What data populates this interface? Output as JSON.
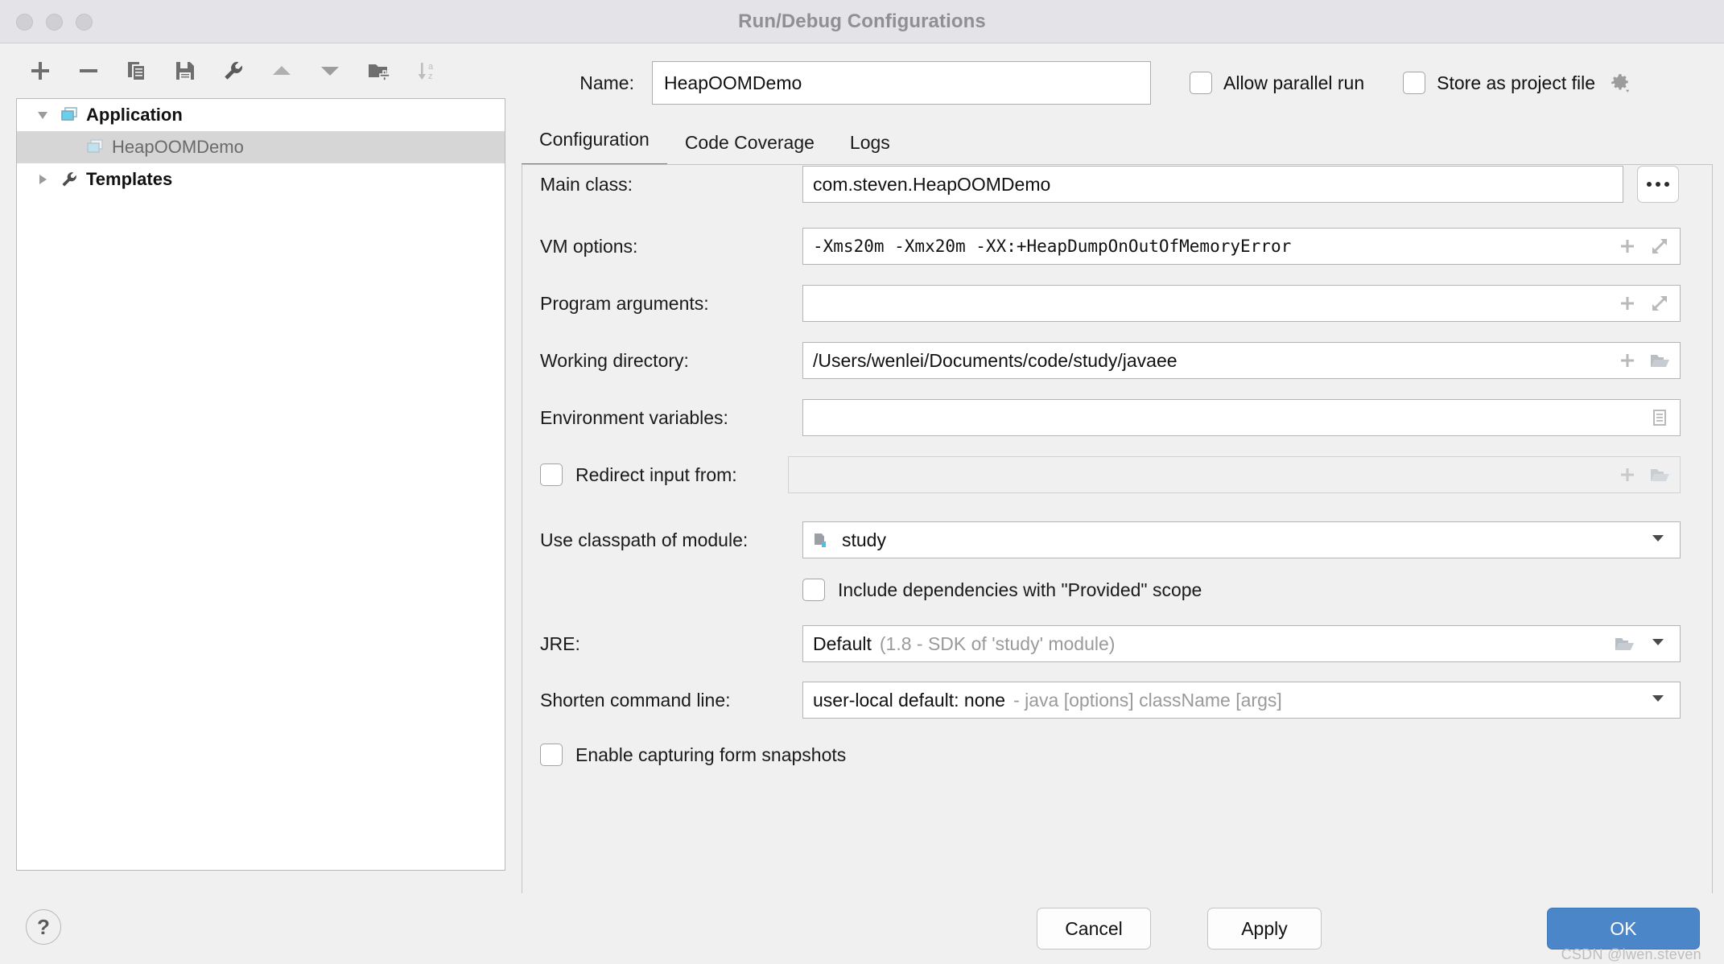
{
  "window": {
    "title": "Run/Debug Configurations",
    "traffic_lights": [
      "close",
      "minimize",
      "zoom"
    ]
  },
  "toolbar": {
    "buttons": [
      {
        "name": "add",
        "icon": "plus-icon",
        "label": "Add New Configuration"
      },
      {
        "name": "remove",
        "icon": "minus-icon",
        "label": "Remove Configuration"
      },
      {
        "name": "copy",
        "icon": "copy-icon",
        "label": "Copy Configuration"
      },
      {
        "name": "save",
        "icon": "save-icon",
        "label": "Save Configuration"
      },
      {
        "name": "edit-templates",
        "icon": "wrench-icon",
        "label": "Edit Templates"
      },
      {
        "name": "move-up",
        "icon": "triangle-up-icon",
        "label": "Move Up"
      },
      {
        "name": "move-down",
        "icon": "triangle-down-icon",
        "label": "Move Down"
      },
      {
        "name": "new-folder",
        "icon": "folder-plus-icon",
        "label": "Create New Folder"
      },
      {
        "name": "sort-alphabetically",
        "icon": "sort-az-icon",
        "label": "Sort Configurations"
      }
    ]
  },
  "tree": {
    "nodes": [
      {
        "label": "Application",
        "icon": "application-icon",
        "expanded": true,
        "selected": false,
        "level": 0
      },
      {
        "label": "HeapOOMDemo",
        "icon": "application-icon",
        "expanded": false,
        "selected": true,
        "level": 1
      },
      {
        "label": "Templates",
        "icon": "wrench-icon",
        "expanded": false,
        "selected": false,
        "level": 0
      }
    ]
  },
  "name_row": {
    "label": "Name:",
    "value": "HeapOOMDemo",
    "allow_parallel_run": {
      "label": "Allow parallel run",
      "checked": false
    },
    "store_as_project_file": {
      "label": "Store as project file",
      "checked": false
    },
    "gear_icon": "gear-icon"
  },
  "tabs": [
    {
      "label": "Configuration",
      "active": true
    },
    {
      "label": "Code Coverage",
      "active": false
    },
    {
      "label": "Logs",
      "active": false
    }
  ],
  "fields": {
    "main_class": {
      "label": "Main class:",
      "value": "com.steven.HeapOOMDemo",
      "browse_label": "..."
    },
    "vm_options": {
      "label": "VM options:",
      "value": "-Xms20m -Xmx20m -XX:+HeapDumpOnOutOfMemoryError",
      "icons": [
        "plus-macro-icon",
        "expand-icon"
      ]
    },
    "program_arguments": {
      "label": "Program arguments:",
      "value": "",
      "icons": [
        "plus-macro-icon",
        "expand-icon"
      ]
    },
    "working_directory": {
      "label": "Working directory:",
      "value": "/Users/wenlei/Documents/code/study/javaee",
      "icons": [
        "plus-macro-icon",
        "folder-icon"
      ]
    },
    "environment_variables": {
      "label": "Environment variables:",
      "value": "",
      "icons": [
        "list-edit-icon"
      ]
    },
    "redirect_input": {
      "label": "Redirect input from:",
      "checked": false,
      "value": "",
      "icons": [
        "plus-macro-icon",
        "folder-icon"
      ],
      "disabled": true
    },
    "use_classpath_of_module": {
      "label": "Use classpath of module:",
      "value": "study",
      "icon": "module-folder-icon"
    },
    "include_provided_scope": {
      "label": "Include dependencies with \"Provided\" scope",
      "checked": false
    },
    "jre": {
      "label": "JRE:",
      "value": "Default",
      "hint": "(1.8 - SDK of 'study' module)",
      "icons": [
        "folder-icon",
        "dropdown-icon"
      ]
    },
    "shorten_command_line": {
      "label": "Shorten command line:",
      "value": "user-local default: none",
      "hint": "- java [options] className [args]",
      "icons": [
        "dropdown-icon"
      ]
    },
    "enable_form_snapshots": {
      "label": "Enable capturing form snapshots",
      "checked": false
    }
  },
  "footer": {
    "help_label": "?",
    "cancel_label": "Cancel",
    "apply_label": "Apply",
    "ok_label": "OK",
    "watermark": "CSDN @lwen.steven"
  },
  "colors": {
    "accent": "#4a86c8",
    "tab_underline": "#4a88c7",
    "selection": "#d6d6d6",
    "titlebar": "#e4e3e8"
  }
}
